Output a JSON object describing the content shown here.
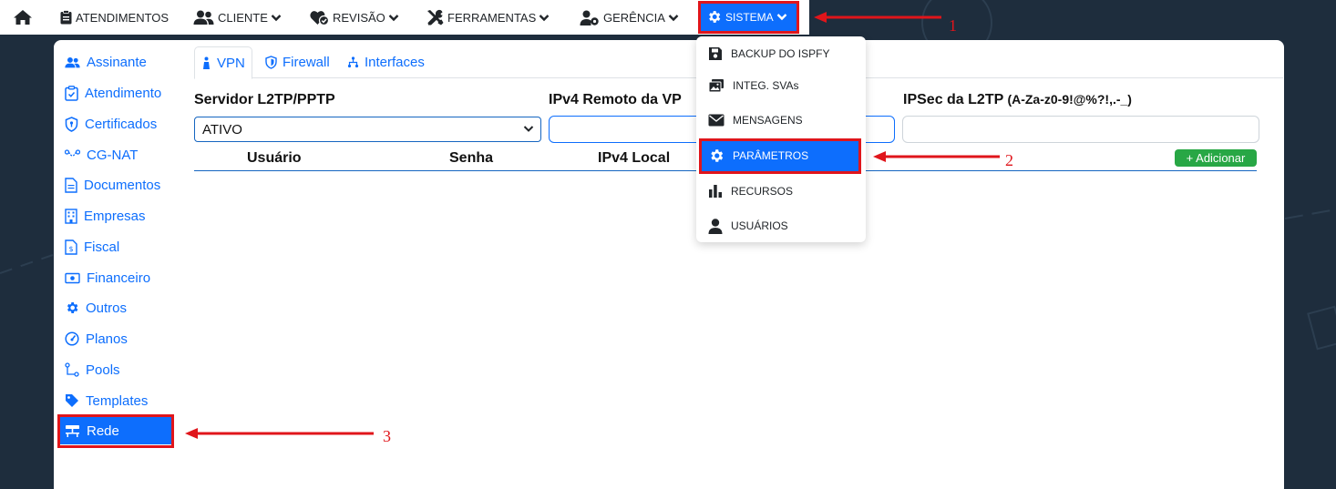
{
  "nav": {
    "items": [
      {
        "label": "ATENDIMENTOS"
      },
      {
        "label": "CLIENTE"
      },
      {
        "label": "REVISÃO"
      },
      {
        "label": "FERRAMENTAS"
      },
      {
        "label": "GERÊNCIA"
      }
    ],
    "sistema_label": "SISTEMA"
  },
  "sidebar": {
    "items": [
      {
        "label": "Assinante"
      },
      {
        "label": "Atendimento"
      },
      {
        "label": "Certificados"
      },
      {
        "label": "CG-NAT"
      },
      {
        "label": "Documentos"
      },
      {
        "label": "Empresas"
      },
      {
        "label": "Fiscal"
      },
      {
        "label": "Financeiro"
      },
      {
        "label": "Outros"
      },
      {
        "label": "Planos"
      },
      {
        "label": "Pools"
      },
      {
        "label": "Templates"
      },
      {
        "label": "Rede"
      }
    ]
  },
  "tabs": [
    {
      "label": "VPN"
    },
    {
      "label": "Firewall"
    },
    {
      "label": "Interfaces"
    }
  ],
  "form": {
    "server_label": "Servidor L2TP/PPTP",
    "server_value": "ATIVO",
    "ipv4_remote_label": "IPv4 Remoto da VP",
    "ipsec_label": "IPSec da L2TP",
    "ipsec_hint": "(A-Za-z0-9!@%?!,.-_)"
  },
  "table": {
    "headers": [
      "Usuário",
      "Senha",
      "IPv4 Local"
    ],
    "add_label": "+ Adicionar"
  },
  "dropdown": {
    "items": [
      {
        "label": "BACKUP DO ISPFY"
      },
      {
        "label": "INTEG. SVAs"
      },
      {
        "label": "MENSAGENS"
      },
      {
        "label": "PARÂMETROS"
      },
      {
        "label": "RECURSOS"
      },
      {
        "label": "USUÁRIOS"
      }
    ]
  },
  "annotations": {
    "step1": "1",
    "step2": "2",
    "step3": "3"
  },
  "colors": {
    "primary": "#0d6efd",
    "success": "#28a745",
    "annotation": "#e0151b",
    "background": "#1e2d3d"
  }
}
